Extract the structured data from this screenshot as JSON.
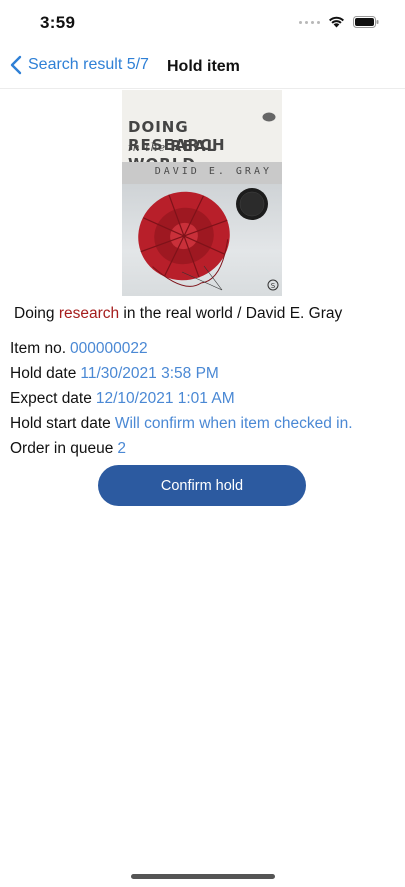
{
  "status_bar": {
    "time": "3:59",
    "icons": [
      "signal-dots-icon",
      "wifi-icon",
      "battery-icon"
    ]
  },
  "nav": {
    "back_label": "Search result 5/7",
    "title": "Hold item",
    "accent_color": "#2f80d6"
  },
  "book": {
    "cover": {
      "title_line1": "DOING RESEARCH",
      "title_line2_small": "in the",
      "title_line2": "REAL WORLD",
      "author": "DAVID E. GRAY",
      "publisher_mark": "S"
    },
    "title_prefix": "Doing ",
    "title_highlight": "research",
    "title_suffix": " in the real world / David E. Gray",
    "highlight_color": "#a51d1d"
  },
  "details": [
    {
      "label": "Item no.",
      "value": "000000022"
    },
    {
      "label": "Hold date",
      "value": "11/30/2021 3:58 PM"
    },
    {
      "label": "Expect date",
      "value": "12/10/2021 1:01 AM"
    },
    {
      "label": "Hold start date",
      "value": "Will confirm when item checked in."
    },
    {
      "label": "Order in queue",
      "value": "2"
    }
  ],
  "actions": {
    "confirm_label": "Confirm hold",
    "confirm_color": "#2c5aa0"
  }
}
